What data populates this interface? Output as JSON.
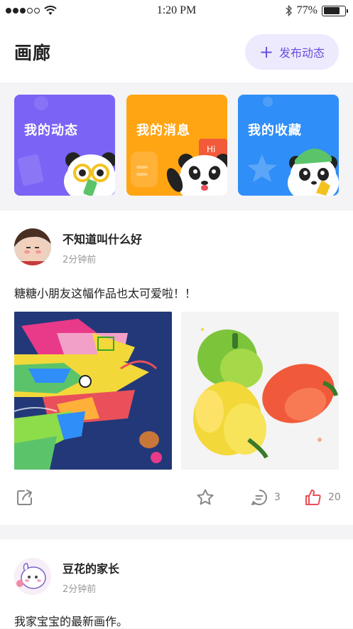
{
  "status_bar": {
    "time": "1:20 PM",
    "battery": "77%",
    "battery_level": 0.77
  },
  "header": {
    "title": "画廊",
    "post_button_label": "发布动态"
  },
  "cards": [
    {
      "label": "我的动态",
      "color": "#7b63f5"
    },
    {
      "label": "我的消息",
      "color": "#ffa514"
    },
    {
      "label": "我的收藏",
      "color": "#2f8ef7"
    }
  ],
  "card_badge": "Hi",
  "posts": [
    {
      "user": "不知道叫什么好",
      "time": "2分钟前",
      "text": "糖糖小朋友这幅作品也太可爱啦！！",
      "comments": "3",
      "likes": "20"
    },
    {
      "user": "豆花的家长",
      "time": "2分钟前",
      "text": "我家宝宝的最新画作。"
    }
  ],
  "colors": {
    "accent": "#6a4fe0",
    "like": "#e9505a",
    "icon": "#888888"
  }
}
